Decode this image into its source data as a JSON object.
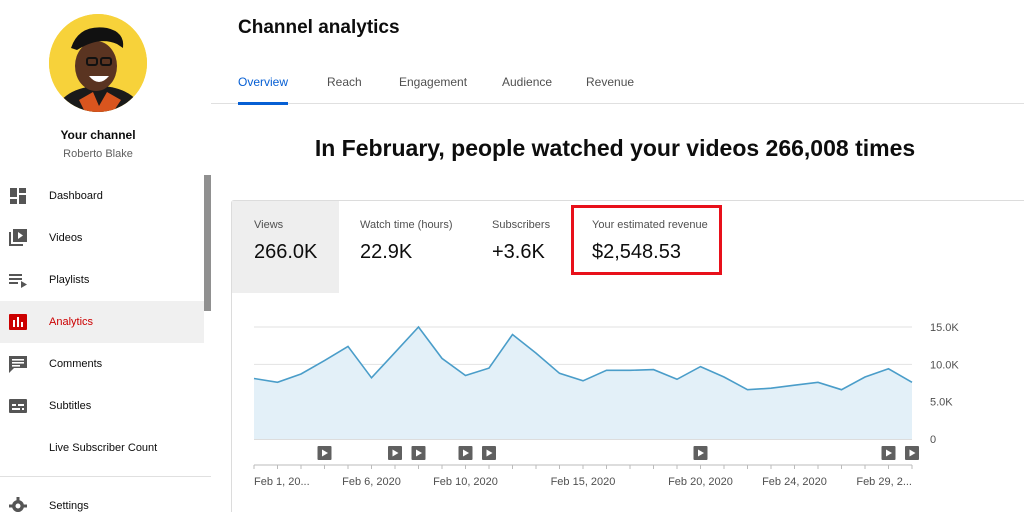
{
  "sidebar": {
    "channel_label": "Your channel",
    "channel_name": "Roberto Blake",
    "items": [
      {
        "label": "Dashboard",
        "icon": "dashboard-icon"
      },
      {
        "label": "Videos",
        "icon": "videos-icon"
      },
      {
        "label": "Playlists",
        "icon": "playlists-icon"
      },
      {
        "label": "Analytics",
        "icon": "analytics-icon",
        "active": true
      },
      {
        "label": "Comments",
        "icon": "comments-icon"
      },
      {
        "label": "Subtitles",
        "icon": "subtitles-icon"
      },
      {
        "label": "Live Subscriber Count",
        "icon": ""
      }
    ],
    "settings_label": "Settings",
    "active_color": "#cc0000"
  },
  "header": {
    "title": "Channel analytics",
    "tabs": [
      {
        "label": "Overview",
        "active": true
      },
      {
        "label": "Reach"
      },
      {
        "label": "Engagement"
      },
      {
        "label": "Audience"
      },
      {
        "label": "Revenue"
      }
    ],
    "accent_color": "#065fd4"
  },
  "headline": "In February, people watched your videos 266,008 times",
  "metrics": [
    {
      "label": "Views",
      "value": "266.0K",
      "selected": true
    },
    {
      "label": "Watch time (hours)",
      "value": "22.9K"
    },
    {
      "label": "Subscribers",
      "value": "+3.6K"
    },
    {
      "label": "Your estimated revenue",
      "value": "$2,548.53",
      "highlighted": true
    }
  ],
  "highlight_color": "#e8101a",
  "chart_data": {
    "type": "area",
    "series": [
      {
        "values": [
          8100,
          7600,
          8700,
          10500,
          12400,
          8200,
          11600,
          15000,
          10800,
          8500,
          9500,
          14000,
          11500,
          8800,
          7800,
          9200,
          9200,
          9300,
          8000,
          9700,
          8300,
          6600,
          6800,
          7200,
          7600,
          6600,
          8300,
          9400,
          7600
        ]
      }
    ],
    "x_labels": [
      "Feb 1, 20...",
      "Feb 6, 2020",
      "Feb 10, 2020",
      "Feb 15, 2020",
      "Feb 20, 2020",
      "Feb 24, 2020",
      "Feb 29, 2..."
    ],
    "x_label_days": [
      1,
      6,
      10,
      15,
      20,
      24,
      29
    ],
    "y_ticks": [
      "15.0K",
      "10.0K",
      "5.0K",
      "0"
    ],
    "y_tick_values": [
      15000,
      10000,
      5000,
      0
    ],
    "ylim": [
      0,
      15000
    ],
    "grid": true,
    "line_color": "#4a9dc9",
    "fill_color": "#e3f0f8",
    "video_markers_days": [
      4,
      7,
      8,
      10,
      11,
      20,
      28,
      29
    ]
  }
}
